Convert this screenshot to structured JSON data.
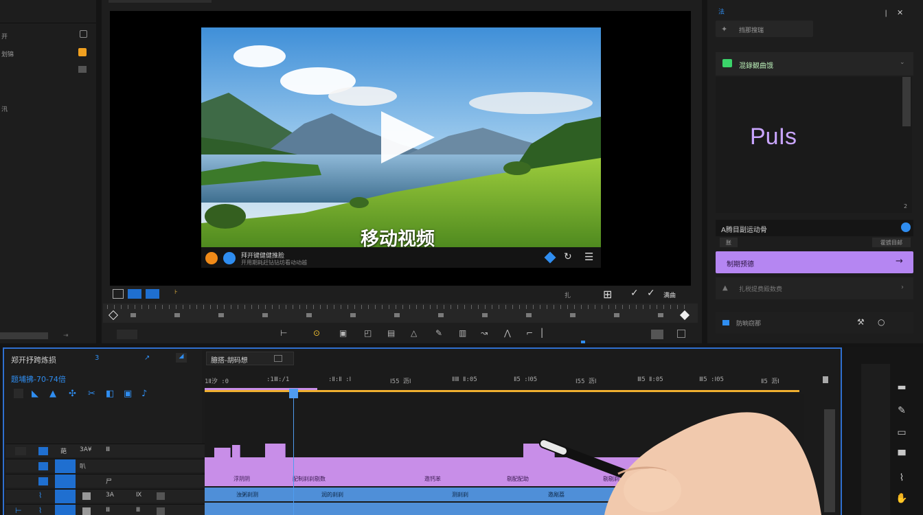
{
  "colors": {
    "accent": "#2f8df0",
    "purple": "#b586f2",
    "timeline_clip": "#c88ee8",
    "audio_clip": "#4f8fd8",
    "green": "#3bd46a",
    "playhead": "#f0b030"
  },
  "preview": {
    "caption": "移动视频",
    "info_line1": "拜开键健健推脸",
    "info_line2": "开用期耗赶钻钻坊看动动越"
  },
  "left_panel": {
    "items": [
      "开",
      "划锦",
      "汛",
      "汀"
    ]
  },
  "right_panel": {
    "top_label": "法",
    "effect_label": "挡那搜瑞",
    "section_title": "混錄観曲饿",
    "logo_text": "PuIs",
    "sub_title": "A腾目副运动骨",
    "tag_left": "胀",
    "tag_right": "霍掳目邮",
    "purple_button": "制期预德",
    "row_label": "扎税提费殿数费",
    "bottom_label": "防晌窃那"
  },
  "preview_toolbar": {
    "left_label": "扎",
    "right_label": "满曲",
    "tick_label": "扎"
  },
  "timeline": {
    "panel_title": "郑开抒跨炼损",
    "track_label": "题埔拂-70-74倍",
    "tab_label": "臆搭-胡码想",
    "tab_sub": "3",
    "ruler": [
      "1Ⅱ汐 :0",
      ":1Ⅲ:/1",
      ":Ⅱ:Ⅱ :Ⅰ",
      "Ⅰ55 沥Ⅰ",
      "ⅡⅢ Ⅱ:05",
      "Ⅱ5 :Ⅰ05",
      "Ⅰ55 沥Ⅰ",
      "Ⅲ5 Ⅱ:05",
      "Ⅲ5 :Ⅰ05",
      "Ⅱ5 沥Ⅰ"
    ],
    "header_rows": [
      {
        "a": "葩",
        "b": "3A¥",
        "c": "Ⅲ"
      },
      {
        "a": "",
        "b": "叭",
        "c": ""
      },
      {
        "a": "",
        "b": "尸",
        "c": ""
      },
      {
        "a": "",
        "b": "3A",
        "c": "Ⅸ"
      },
      {
        "a": "",
        "b": "Ⅲ",
        "c": "Ⅲ"
      }
    ],
    "clip_labels": [
      "浮阴阴",
      "配制刹刹剔数",
      "邀钙苯",
      "剔配配助",
      "剔剔刹"
    ],
    "audio_labels": [
      "浊粥刹测",
      "润的刹刹",
      "测刹刹",
      "邀剐荔"
    ]
  }
}
